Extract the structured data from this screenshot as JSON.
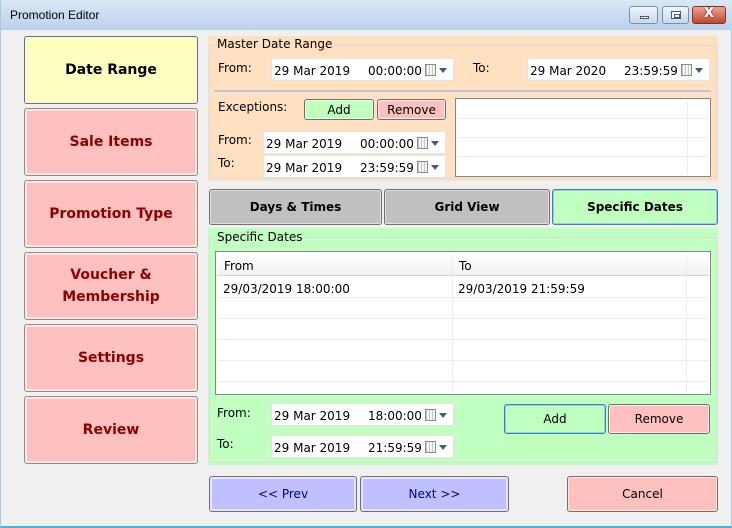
{
  "window": {
    "title": "Promotion Editor",
    "controls": [
      "minimize",
      "maximize",
      "close"
    ],
    "close_glyph": "X"
  },
  "sidebar": {
    "items": [
      {
        "label": "Date Range",
        "active": true
      },
      {
        "label": "Sale Items",
        "active": false
      },
      {
        "label": "Promotion Type",
        "active": false
      },
      {
        "label": "Voucher & Membership",
        "active": false
      },
      {
        "label": "Settings",
        "active": false
      },
      {
        "label": "Review",
        "active": false
      }
    ]
  },
  "master": {
    "group_label": "Master Date Range",
    "from_label": "From:",
    "from_date": "29 Mar 2019",
    "from_time": "00:00:00",
    "to_label": "To:",
    "to_date": "29 Mar 2020",
    "to_time": "23:59:59"
  },
  "exceptions": {
    "label": "Exceptions:",
    "add_label": "Add",
    "remove_label": "Remove",
    "from_label": "From:",
    "from_date": "29 Mar 2019",
    "from_time": "00:00:00",
    "to_label": "To:",
    "to_date": "29 Mar 2019",
    "to_time": "23:59:59",
    "rows": []
  },
  "tabs": [
    {
      "label": "Days & Times",
      "active": false
    },
    {
      "label": "Grid View",
      "active": false
    },
    {
      "label": "Specific Dates",
      "active": true
    }
  ],
  "specific": {
    "group_label": "Specific Dates",
    "columns": [
      "From",
      "To"
    ],
    "rows": [
      {
        "from": "29/03/2019 18:00:00",
        "to": "29/03/2019 21:59:59"
      }
    ],
    "from_label": "From:",
    "from_date": "29 Mar 2019",
    "from_time": "18:00:00",
    "to_label": "To:",
    "to_date": "29 Mar 2019",
    "to_time": "21:59:59",
    "add_label": "Add",
    "remove_label": "Remove"
  },
  "footer": {
    "prev_label": "<< Prev",
    "next_label": "Next >>",
    "cancel_label": "Cancel"
  },
  "colors": {
    "active_nav": "#ffffc0",
    "inactive_nav": "#ffc0c0",
    "nav_text": "#8b0000",
    "master_panel": "#ffe0c0",
    "specific_panel": "#c0ffc0",
    "nav_button": "#c0c0ff",
    "cancel_button": "#ffc0c0"
  }
}
